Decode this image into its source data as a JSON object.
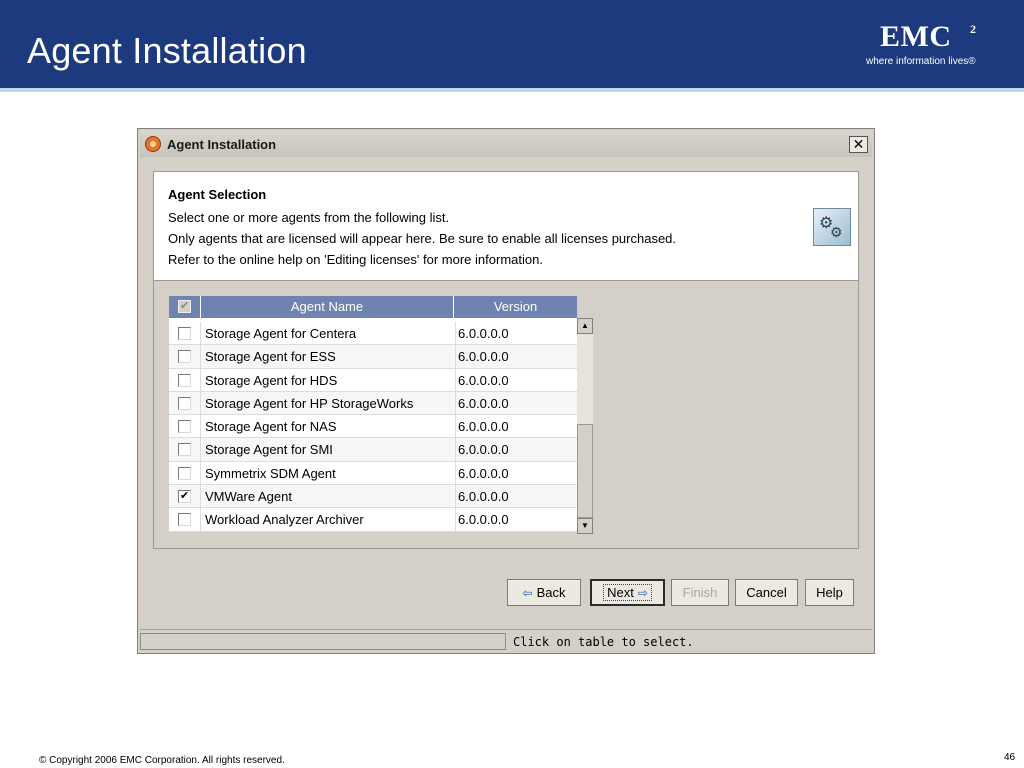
{
  "slide": {
    "title": "Agent Installation",
    "logo": {
      "mark": "EMC",
      "superscript": "2",
      "tagline": "where information lives®"
    },
    "footer": "© Copyright 2006 EMC Corporation. All rights reserved.",
    "page_number": "46"
  },
  "dialog": {
    "title": "Agent Installation",
    "close_label": "✕",
    "header": {
      "title": "Agent Selection",
      "lines": [
        "Select one or more agents from the following list.",
        "Only agents that are licensed will appear here. Be sure to enable all licenses purchased.",
        "Refer to the online help on 'Editing licenses' for more information."
      ]
    },
    "table": {
      "columns": [
        "Agent Name",
        "Version"
      ],
      "header_check": "✔",
      "rows": [
        {
          "checked": false,
          "name": "Storage Agent for Centera",
          "version": "6.0.0.0.0"
        },
        {
          "checked": false,
          "name": "Storage Agent for ESS",
          "version": "6.0.0.0.0"
        },
        {
          "checked": false,
          "name": "Storage Agent for HDS",
          "version": "6.0.0.0.0"
        },
        {
          "checked": false,
          "name": "Storage Agent for HP StorageWorks",
          "version": "6.0.0.0.0"
        },
        {
          "checked": false,
          "name": "Storage Agent for NAS",
          "version": "6.0.0.0.0"
        },
        {
          "checked": false,
          "name": "Storage Agent for SMI",
          "version": "6.0.0.0.0"
        },
        {
          "checked": false,
          "name": "Symmetrix SDM Agent",
          "version": "6.0.0.0.0"
        },
        {
          "checked": true,
          "name": "VMWare Agent",
          "version": "6.0.0.0.0"
        },
        {
          "checked": false,
          "name": "Workload Analyzer Archiver",
          "version": "6.0.0.0.0"
        }
      ]
    },
    "buttons": {
      "back": "Back",
      "next": "Next",
      "finish": "Finish",
      "cancel": "Cancel",
      "help": "Help"
    },
    "status_text": "Click on table to select.",
    "colors": {
      "header_bar": "#1d3a7e",
      "table_header": "#6f83b1",
      "accent_rule": "#b9d7ea"
    }
  }
}
